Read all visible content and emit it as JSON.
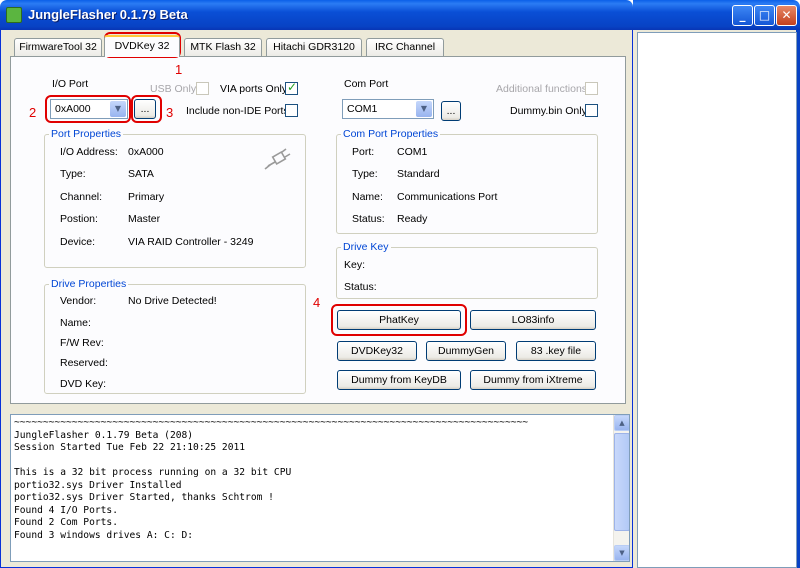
{
  "window": {
    "title": "JungleFlasher 0.1.79 Beta"
  },
  "tabs": [
    {
      "label": "FirmwareTool 32"
    },
    {
      "label": "DVDKey 32"
    },
    {
      "label": "MTK Flash 32"
    },
    {
      "label": "Hitachi GDR3120"
    },
    {
      "label": "IRC Channel"
    }
  ],
  "io": {
    "label": "I/O Port",
    "value": "0xA000",
    "browse": "...",
    "usb_only": "USB Only",
    "via_ports_only": "VIA ports Only",
    "include_non_ide": "Include non-IDE Ports"
  },
  "com": {
    "label": "Com Port",
    "value": "COM1",
    "browse": "...",
    "additional_functions": "Additional functions",
    "dummy_bin_only": "Dummy.bin Only"
  },
  "port_properties": {
    "title": "Port Properties",
    "rows": [
      {
        "label": "I/O Address:",
        "value": "0xA000"
      },
      {
        "label": "Type:",
        "value": "SATA"
      },
      {
        "label": "Channel:",
        "value": "Primary"
      },
      {
        "label": "Postion:",
        "value": "Master"
      },
      {
        "label": "Device:",
        "value": "VIA RAID Controller - 3249"
      }
    ]
  },
  "com_port_properties": {
    "title": "Com Port Properties",
    "rows": [
      {
        "label": "Port:",
        "value": "COM1"
      },
      {
        "label": "Type:",
        "value": "Standard"
      },
      {
        "label": "Name:",
        "value": "Communications Port"
      },
      {
        "label": "Status:",
        "value": "Ready"
      }
    ]
  },
  "drive_properties": {
    "title": "Drive Properties",
    "rows": [
      {
        "label": "Vendor:",
        "value": "No Drive Detected!"
      },
      {
        "label": "Name:",
        "value": ""
      },
      {
        "label": "F/W Rev:",
        "value": ""
      },
      {
        "label": "Reserved:",
        "value": ""
      },
      {
        "label": "DVD Key:",
        "value": ""
      }
    ]
  },
  "drive_key": {
    "title": "Drive Key",
    "key_label": "Key:",
    "status_label": "Status:"
  },
  "buttons": {
    "phatkey": "PhatKey",
    "lo83info": "LO83info",
    "dvdkey32": "DVDKey32",
    "dummygen": "DummyGen",
    "key_file": "83 .key file",
    "dummy_keydb": "Dummy from KeyDB",
    "dummy_ixtreme": "Dummy from iXtreme"
  },
  "annotations": {
    "n1": "1",
    "n2": "2",
    "n3": "3",
    "n4": "4"
  },
  "log": {
    "lines": "~~~~~~~~~~~~~~~~~~~~~~~~~~~~~~~~~~~~~~~~~~~~~~~~~~~~~~~~~~~~~~~~~~~~~~~~~~~~~~~~~~~~~~~~~\nJungleFlasher 0.1.79 Beta (208)\nSession Started Tue Feb 22 21:10:25 2011\n\nThis is a 32 bit process running on a 32 bit CPU\nportio32.sys Driver Installed\nportio32.sys Driver Started, thanks Schtrom !\nFound 4 I/O Ports.\nFound 2 Com Ports.\nFound 3 windows drives A: C: D:"
  },
  "colors": {
    "titlebar": "#0a4fd6",
    "group_title": "#0046d5",
    "annotation": "#e00000",
    "window_bg": "#ece9d8"
  }
}
